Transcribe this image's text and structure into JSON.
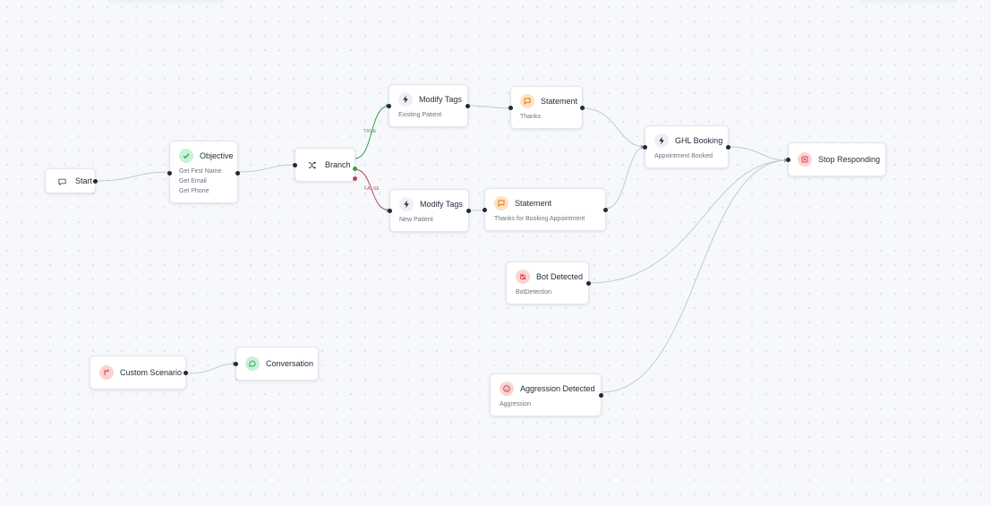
{
  "nodes": {
    "start": {
      "title": "Start"
    },
    "objective": {
      "title": "Objective",
      "items": [
        "Get First Name",
        "Get Email",
        "Get Phone"
      ]
    },
    "branch": {
      "title": "Branch"
    },
    "modify_tags_1": {
      "title": "Modify Tags",
      "subtitle": "Existing Patient"
    },
    "modify_tags_2": {
      "title": "Modify Tags",
      "subtitle": "New Patient"
    },
    "statement_1": {
      "title": "Statement",
      "subtitle": "Thanks"
    },
    "statement_2": {
      "title": "Statement",
      "subtitle": "Thanks for Booking Appointment"
    },
    "ghl_booking": {
      "title": "GHL Booking",
      "subtitle": "Appointment Booked"
    },
    "stop_responding": {
      "title": "Stop Responding"
    },
    "bot_detected": {
      "title": "Bot Detected",
      "subtitle": "BotDetection"
    },
    "aggression_detected": {
      "title": "Aggression Detected",
      "subtitle": "Aggression"
    },
    "custom_scenario": {
      "title": "Custom Scenario"
    },
    "conversation": {
      "title": "Conversation"
    }
  },
  "edge_labels": {
    "true_label": "TRUE",
    "false_label": "FALSE"
  },
  "colors": {
    "edge": "#c5c9d1",
    "true_edge": "#3f9b4a",
    "false_edge": "#b04a56"
  }
}
